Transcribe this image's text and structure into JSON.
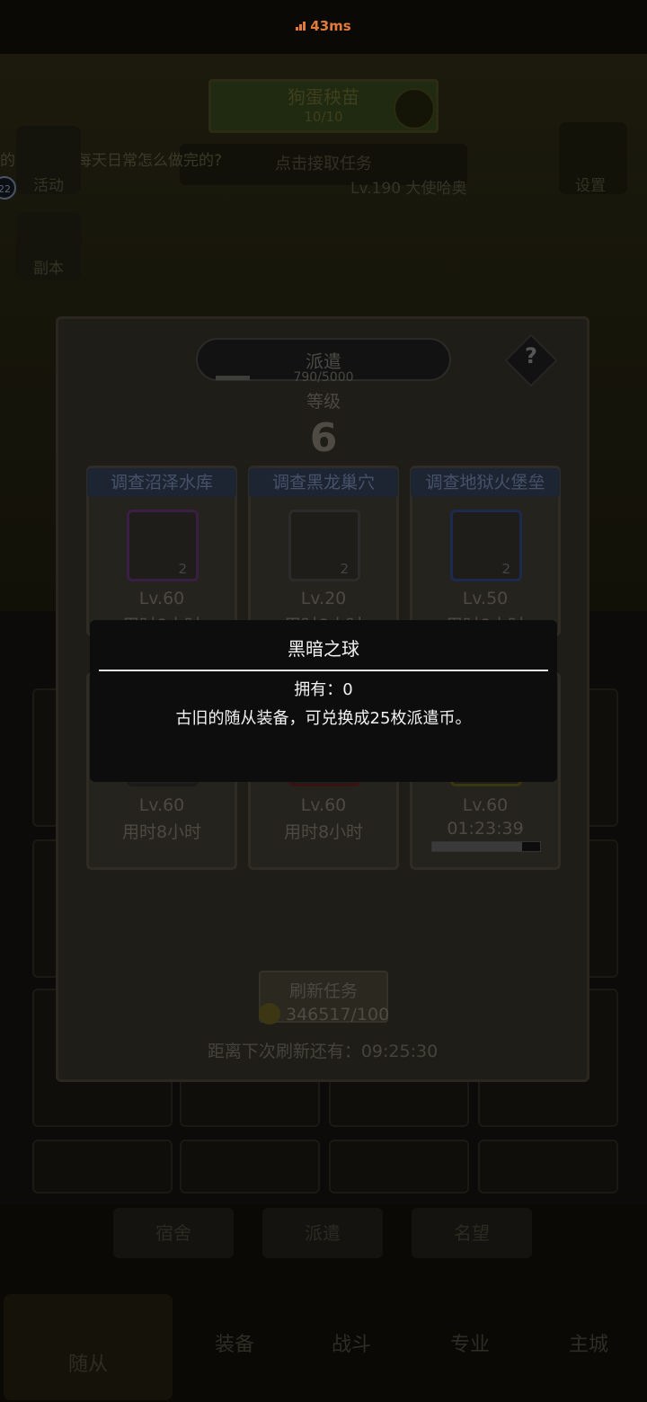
{
  "status": {
    "ping": "43ms"
  },
  "top": {
    "task_title": "狗蛋秧苗",
    "task_progress": "10/10",
    "accept_task": "点击接取任务",
    "marquee": "的大佬们，每天日常怎么做完的?",
    "player_line": "Lv.190 大使哈奥",
    "settings_label": "设置",
    "badge": "22"
  },
  "side": [
    {
      "label": "活动"
    },
    {
      "label": "副本"
    }
  ],
  "panel": {
    "title": "派遣",
    "exp": "790/5000",
    "level_label": "等级",
    "level": "6",
    "help": "?",
    "cards_row1": [
      {
        "title": "调查沼泽水库",
        "count": "2",
        "level": "Lv.60",
        "time": "用时8小时"
      },
      {
        "title": "调查黑龙巢穴",
        "count": "2",
        "level": "Lv.20",
        "time": "用时8小时"
      },
      {
        "title": "调查地狱火堡垒",
        "count": "2",
        "level": "Lv.50",
        "time": "用时8小时"
      }
    ],
    "cards_row2": [
      {
        "level": "Lv.60",
        "time": "用时8小时"
      },
      {
        "level": "Lv.60",
        "time": "用时8小时"
      },
      {
        "level": "Lv.60",
        "time": "01:23:39",
        "progress": 0.83
      }
    ],
    "refresh_label": "刷新任务",
    "refresh_cost": "346517/100",
    "countdown": "距离下次刷新还有：09:25:30"
  },
  "tooltip": {
    "title": "黑暗之球",
    "owned": "拥有：0",
    "description": "古旧的随从装备，可兑换成25枚派遣币。"
  },
  "bottom_tabs": [
    "宿舍",
    "派遣",
    "名望"
  ],
  "nav": [
    {
      "label": "随从"
    },
    {
      "label": "装备"
    },
    {
      "label": "战斗"
    },
    {
      "label": "专业"
    },
    {
      "label": "主城"
    }
  ],
  "colors": {
    "ping": "#e27a3a",
    "tooltip_bg": "#0d0d0d",
    "tooltip_text": "#f2f2f2"
  }
}
